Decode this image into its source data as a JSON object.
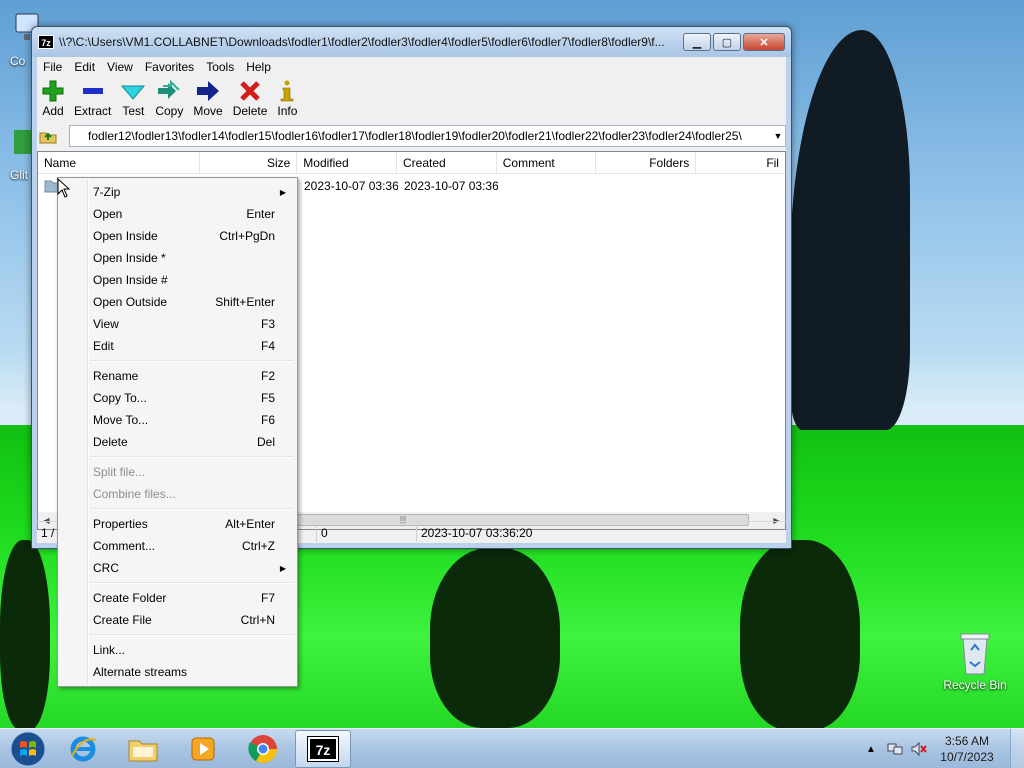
{
  "window": {
    "title": "\\\\?\\C:\\Users\\VM1.COLLABNET\\Downloads\\fodler1\\fodler2\\fodler3\\fodler4\\fodler5\\fodler6\\fodler7\\fodler8\\fodler9\\f...",
    "app_icon_text": "7z",
    "minimize": "▁",
    "maximize": "▢",
    "close": "✕"
  },
  "menubar": [
    "File",
    "Edit",
    "View",
    "Favorites",
    "Tools",
    "Help"
  ],
  "toolbar": [
    {
      "label": "Add",
      "icon": "plus-icon",
      "color": "#1fa31f"
    },
    {
      "label": "Extract",
      "icon": "minus-icon",
      "color": "#1c2fc4"
    },
    {
      "label": "Test",
      "icon": "check-icon",
      "color": "#16b3c4"
    },
    {
      "label": "Copy",
      "icon": "double-arrow-icon",
      "color": "#1f8f7a"
    },
    {
      "label": "Move",
      "icon": "arrow-right-icon",
      "color": "#15238f"
    },
    {
      "label": "Delete",
      "icon": "x-icon",
      "color": "#d21b1b"
    },
    {
      "label": "Info",
      "icon": "info-icon",
      "color": "#c9a400"
    }
  ],
  "address": {
    "path": "fodler12\\fodler13\\fodler14\\fodler15\\fodler16\\fodler17\\fodler18\\fodler19\\fodler20\\fodler21\\fodler22\\fodler23\\fodler24\\fodler25\\"
  },
  "list": {
    "columns": [
      "Name",
      "Size",
      "Modified",
      "Created",
      "Comment",
      "Folders",
      "Fil"
    ],
    "rows": [
      {
        "name": "",
        "size": "",
        "modified": "2023-10-07 03:36",
        "created": "2023-10-07 03:36",
        "comment": "",
        "folders": ""
      }
    ]
  },
  "statusbar": {
    "selection": "1 /",
    "size": "0",
    "modified": "2023-10-07 03:36:20"
  },
  "context_menu": [
    {
      "label": "7-Zip",
      "key": "",
      "submenu": true
    },
    {
      "label": "Open",
      "key": "Enter"
    },
    {
      "label": "Open Inside",
      "key": "Ctrl+PgDn"
    },
    {
      "label": "Open Inside *",
      "key": ""
    },
    {
      "label": "Open Inside #",
      "key": ""
    },
    {
      "label": "Open Outside",
      "key": "Shift+Enter"
    },
    {
      "label": "View",
      "key": "F3"
    },
    {
      "label": "Edit",
      "key": "F4"
    },
    {
      "separator": true
    },
    {
      "label": "Rename",
      "key": "F2"
    },
    {
      "label": "Copy To...",
      "key": "F5"
    },
    {
      "label": "Move To...",
      "key": "F6"
    },
    {
      "label": "Delete",
      "key": "Del"
    },
    {
      "separator": true
    },
    {
      "label": "Split file...",
      "key": "",
      "disabled": true
    },
    {
      "label": "Combine files...",
      "key": "",
      "disabled": true
    },
    {
      "separator": true
    },
    {
      "label": "Properties",
      "key": "Alt+Enter"
    },
    {
      "label": "Comment...",
      "key": "Ctrl+Z"
    },
    {
      "label": "CRC",
      "key": "",
      "submenu": true
    },
    {
      "separator": true
    },
    {
      "label": "Create Folder",
      "key": "F7"
    },
    {
      "label": "Create File",
      "key": "Ctrl+N"
    },
    {
      "separator": true
    },
    {
      "label": "Link...",
      "key": ""
    },
    {
      "label": "Alternate streams",
      "key": ""
    }
  ],
  "desktop": {
    "icons": [
      {
        "label": "Co",
        "icon": "computer-icon"
      },
      {
        "label": "Glit",
        "icon": "app-icon"
      },
      {
        "label": "Recycle Bin",
        "icon": "recycle-bin-icon"
      }
    ]
  },
  "taskbar": {
    "apps": [
      {
        "name": "internet-explorer",
        "icon": "ie-icon"
      },
      {
        "name": "file-explorer",
        "icon": "folder-icon"
      },
      {
        "name": "media-player",
        "icon": "media-icon"
      },
      {
        "name": "chrome",
        "icon": "chrome-icon"
      },
      {
        "name": "7zip",
        "icon": "7zip-icon",
        "active": true,
        "text": "7z"
      }
    ],
    "time": "3:56 AM",
    "date": "10/7/2023"
  }
}
